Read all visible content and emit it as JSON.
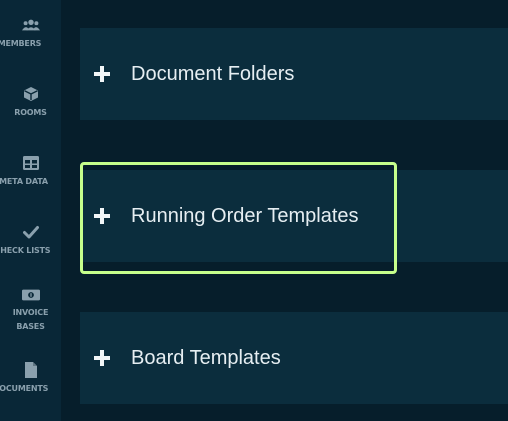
{
  "sidebar": {
    "items": [
      {
        "label": "MEMBERS",
        "icon": "members-icon"
      },
      {
        "label": "ROOMS",
        "icon": "cube-icon"
      },
      {
        "label": "META DATA",
        "icon": "table-icon"
      },
      {
        "label": "CHECK LISTS",
        "icon": "check-icon"
      },
      {
        "label": "INVOICE",
        "label2": "BASES",
        "icon": "money-icon"
      },
      {
        "label": "DOCUMENTS",
        "icon": "document-icon"
      }
    ]
  },
  "panels": [
    {
      "title": "Document Folders"
    },
    {
      "title": "Running Order Templates"
    },
    {
      "title": "Board Templates"
    }
  ],
  "colors": {
    "background": "#061e2b",
    "sidebar": "#092737",
    "panel": "#0b2d3d",
    "highlight": "#c6ff8c",
    "text": "#e6eef2"
  }
}
